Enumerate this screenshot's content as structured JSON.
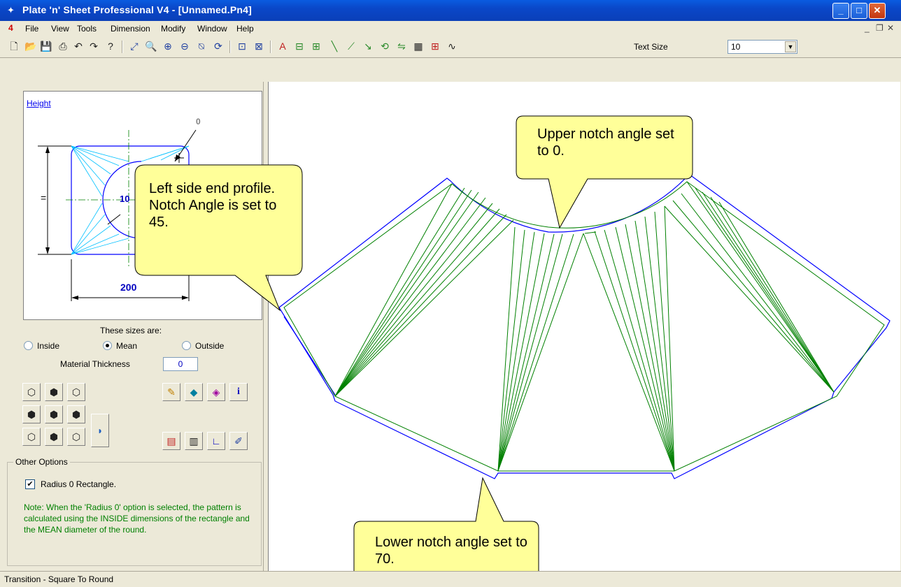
{
  "window": {
    "title": "Plate 'n' Sheet Professional V4 - [Unnamed.Pn4]"
  },
  "menu": [
    "File",
    "View",
    "Tools",
    "Dimension",
    "Modify",
    "Window",
    "Help"
  ],
  "toolbar": {
    "text_size_label": "Text Size",
    "text_size_value": "10"
  },
  "preview": {
    "link": "Height",
    "dim_width": "200",
    "dim_equal": "=",
    "dim_zero": "0",
    "dim_partial": "10"
  },
  "sizes": {
    "label": "These sizes are:",
    "options": [
      "Inside",
      "Mean",
      "Outside"
    ],
    "selected": "Mean"
  },
  "thickness": {
    "label": "Material Thickness",
    "value": "0"
  },
  "other_options": {
    "legend": "Other Options",
    "checkbox_label": "Radius 0 Rectangle.",
    "checked": true,
    "note": "Note:  When the 'Radius 0' option is selected, the pattern is calculated using the INSIDE dimensions of the rectangle and the MEAN diameter of the round."
  },
  "callouts": {
    "upper": "Upper notch angle set to 0.",
    "left": "Left side end profile.  Notch Angle is  set to 45.",
    "lower": "Lower notch angle set to 70."
  },
  "status": "Transition - Square To Round",
  "colors": {
    "outline": "#0000ff",
    "fold_lines": "#008000",
    "callout_fill": "#ffff99",
    "title_blue": "#0a47c8"
  }
}
